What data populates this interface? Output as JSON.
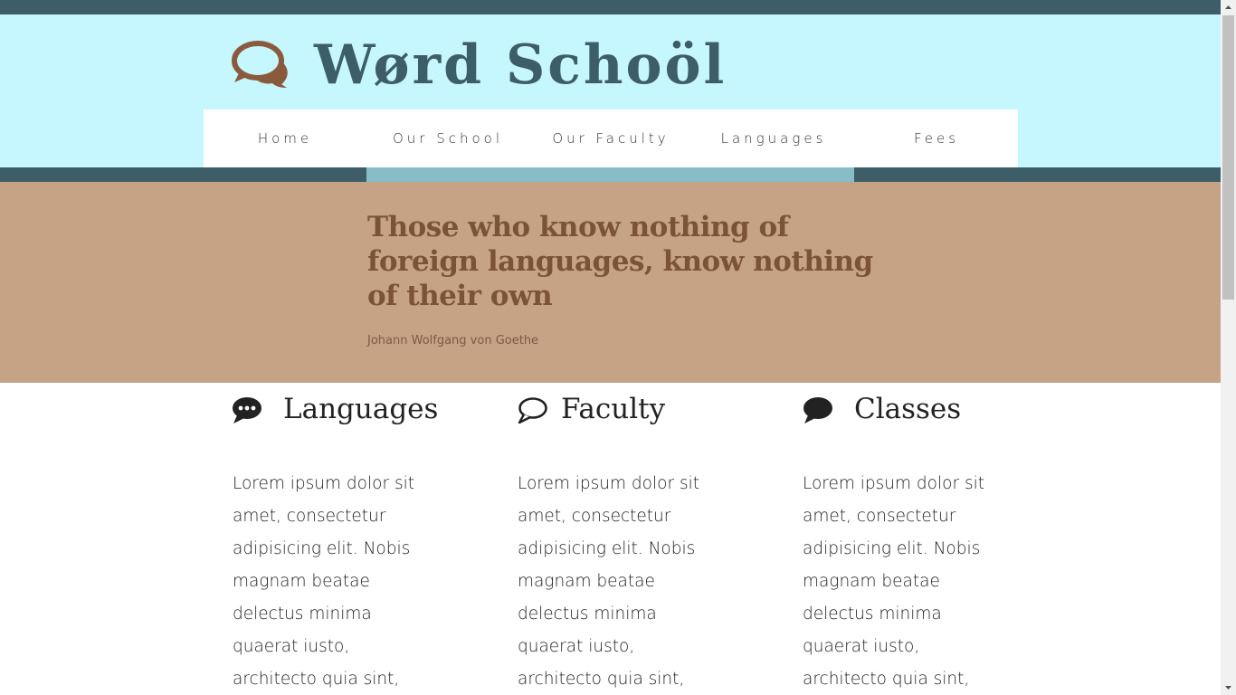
{
  "site": {
    "title": "Wørd Schoöl",
    "logo_icon": "speech-bubbles-icon"
  },
  "nav": {
    "items": [
      {
        "label": "Home"
      },
      {
        "label": "Our School"
      },
      {
        "label": "Our Faculty"
      },
      {
        "label": "Languages"
      },
      {
        "label": "Fees"
      }
    ],
    "active_index": 2
  },
  "hero": {
    "quote": "Those who know nothing of foreign languages, know nothing of their own",
    "author": "Johann Wolfgang von Goethe"
  },
  "columns": [
    {
      "title": "Languages",
      "icon": "speech-bubble-dots-icon",
      "text": "Lorem ipsum dolor sit amet, consectetur adipisicing elit. Nobis magnam beatae delectus minima quaerat iusto, architecto quia sint,"
    },
    {
      "title": "Faculty",
      "icon": "speech-bubble-outline-icon",
      "text": "Lorem ipsum dolor sit amet, consectetur adipisicing elit. Nobis magnam beatae delectus minima quaerat iusto, architecto quia sint,"
    },
    {
      "title": "Classes",
      "icon": "speech-bubble-solid-icon",
      "text": "Lorem ipsum dolor sit amet, consectetur adipisicing elit. Nobis magnam beatae delectus minima quaerat iusto, architecto quia sint,"
    }
  ],
  "colors": {
    "dark_teal": "#3d5e68",
    "light_cyan": "#c6f6fe",
    "active_stripe": "#86bdc6",
    "hero_tan": "#c7a386",
    "quote_brown": "#7b5337",
    "logo_brown": "#8a5a3c"
  }
}
